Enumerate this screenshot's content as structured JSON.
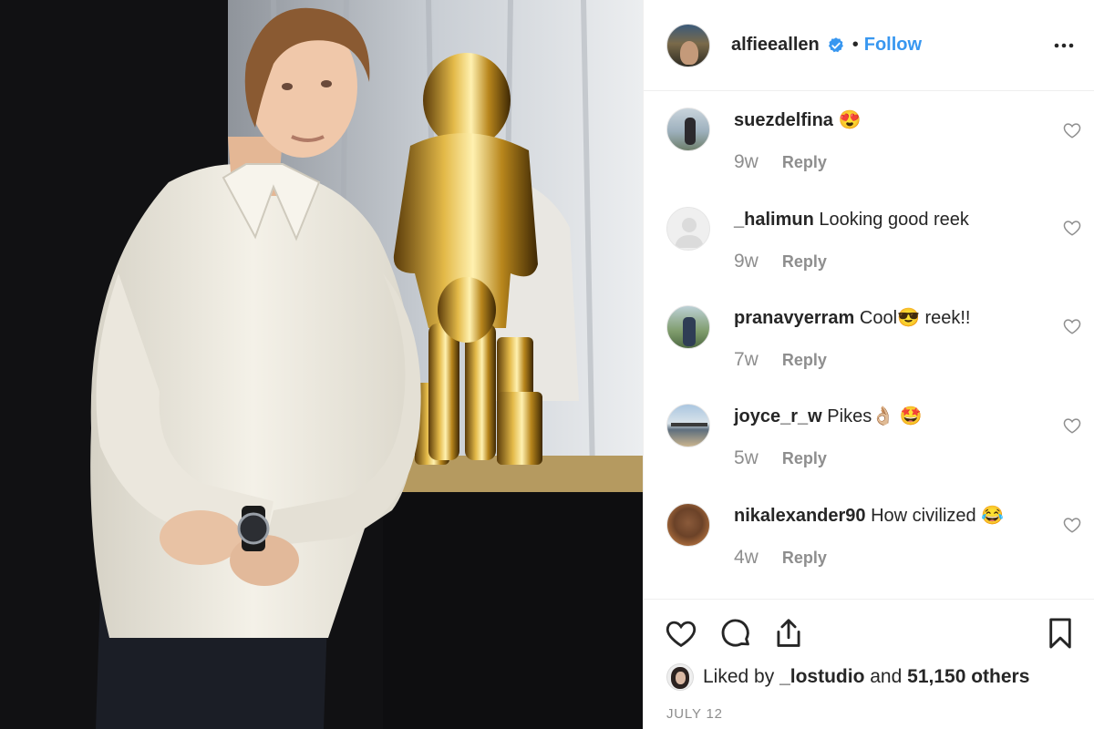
{
  "post": {
    "author": "alfieeallen",
    "separator": "•",
    "follow_label": "Follow",
    "date": "JULY 12"
  },
  "comments": [
    {
      "user": "suezdelfina",
      "text": "😍",
      "time": "9w",
      "reply": "Reply"
    },
    {
      "user": "_halimun",
      "text": "Looking good reek",
      "time": "9w",
      "reply": "Reply"
    },
    {
      "user": "pranavyerram",
      "text": "Cool😎 reek!!",
      "time": "7w",
      "reply": "Reply"
    },
    {
      "user": "joyce_r_w",
      "text": "Pikes👌🏼 🤩",
      "time": "5w",
      "reply": "Reply"
    },
    {
      "user": "nikalexander90",
      "text": "How civilized 😂",
      "time": "4w",
      "reply": "Reply"
    }
  ],
  "likes": {
    "prefix": "Liked by",
    "user": "_lostudio",
    "conjunction": "and",
    "others": "51,150 others"
  },
  "icons": {
    "header": [
      "verified-badge-icon",
      "more-options-icon"
    ],
    "comment": "heart-outline-icon",
    "actions": [
      "like-icon",
      "comment-icon",
      "share-icon",
      "save-bookmark-icon"
    ]
  },
  "colors": {
    "follow": "#3897f0",
    "verified": "#3897f0",
    "secondary_text": "#8e8e8e",
    "primary_text": "#262626"
  }
}
